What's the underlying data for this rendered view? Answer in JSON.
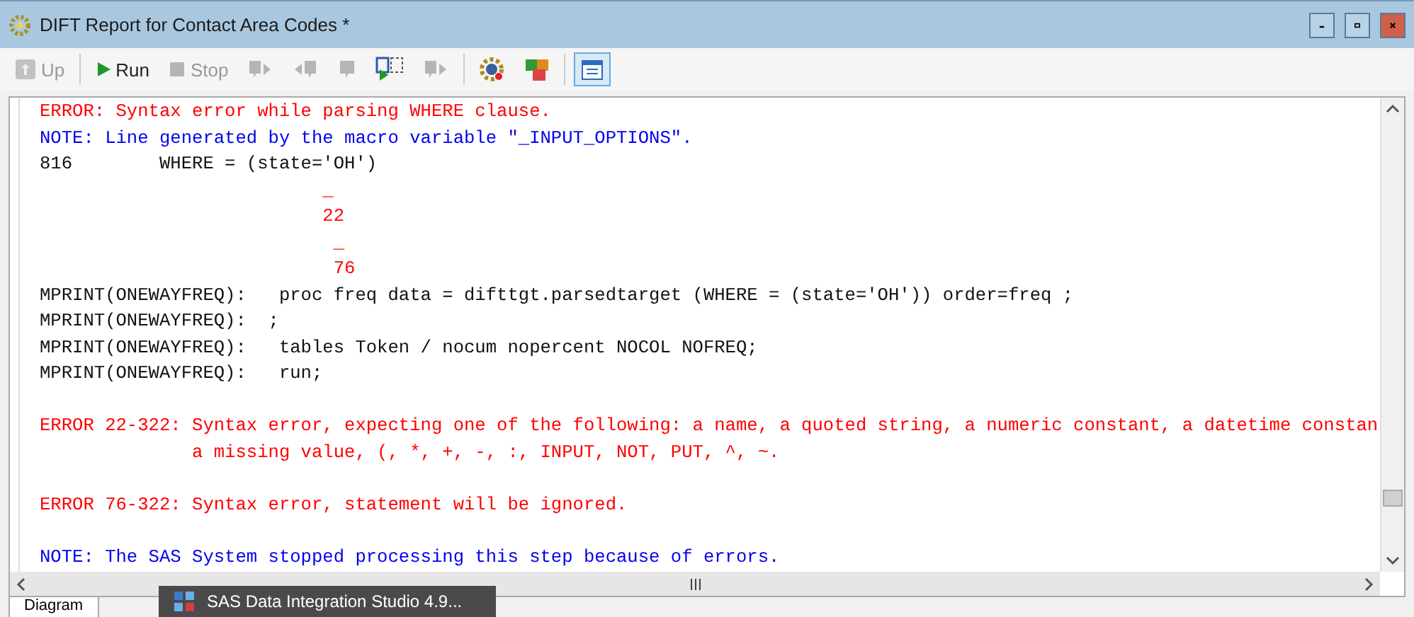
{
  "window": {
    "title": "DIFT Report for Contact Area Codes *"
  },
  "toolbar": [
    {
      "kind": "up",
      "label": "Up",
      "disabled": true,
      "selected": false
    },
    {
      "kind": "run",
      "label": "Run",
      "disabled": false,
      "selected": false
    },
    {
      "kind": "stop",
      "label": "Stop",
      "disabled": true,
      "selected": false
    },
    {
      "kind": "step",
      "disabled": true,
      "selected": false
    },
    {
      "kind": "step-back",
      "disabled": true,
      "selected": false
    },
    {
      "kind": "pause",
      "disabled": true,
      "selected": false
    },
    {
      "kind": "step-run",
      "disabled": false,
      "selected": false
    },
    {
      "kind": "step",
      "disabled": true,
      "selected": false
    },
    {
      "kind": "gear",
      "disabled": false,
      "selected": false
    },
    {
      "kind": "dt",
      "disabled": false,
      "selected": false
    },
    {
      "kind": "log",
      "disabled": false,
      "selected": true
    }
  ],
  "log": [
    {
      "kind": "error",
      "text": "ERROR: Syntax error while parsing WHERE clause."
    },
    {
      "kind": "note",
      "text": "NOTE: Line generated by the macro variable \"_INPUT_OPTIONS\"."
    },
    {
      "kind": "plain",
      "text": "816        WHERE = (state='OH')"
    },
    {
      "kind": "error",
      "text": "                          _"
    },
    {
      "kind": "error",
      "text": "                          22"
    },
    {
      "kind": "error",
      "text": "                           _"
    },
    {
      "kind": "error",
      "text": "                           76"
    },
    {
      "kind": "plain",
      "text": "MPRINT(ONEWAYFREQ):   proc freq data = difttgt.parsedtarget (WHERE = (state='OH')) order=freq ;"
    },
    {
      "kind": "plain",
      "text": "MPRINT(ONEWAYFREQ):  ;"
    },
    {
      "kind": "plain",
      "text": "MPRINT(ONEWAYFREQ):   tables Token / nocum nopercent NOCOL NOFREQ;"
    },
    {
      "kind": "plain",
      "text": "MPRINT(ONEWAYFREQ):   run;"
    },
    {
      "kind": "blank"
    },
    {
      "kind": "error",
      "text": "ERROR 22-322: Syntax error, expecting one of the following: a name, a quoted string, a numeric constant, a datetime constan"
    },
    {
      "kind": "error",
      "text": "              a missing value, (, *, +, -, :, INPUT, NOT, PUT, ^, ~."
    },
    {
      "kind": "blank"
    },
    {
      "kind": "error",
      "text": "ERROR 76-322: Syntax error, statement will be ignored."
    },
    {
      "kind": "blank"
    },
    {
      "kind": "note",
      "text": "NOTE: The SAS System stopped processing this step because of errors."
    }
  ],
  "bottom_tabs": [
    {
      "label": "Diagram",
      "selected": true
    }
  ],
  "taskbar_tooltip": {
    "text": "SAS Data Integration Studio 4.9..."
  }
}
